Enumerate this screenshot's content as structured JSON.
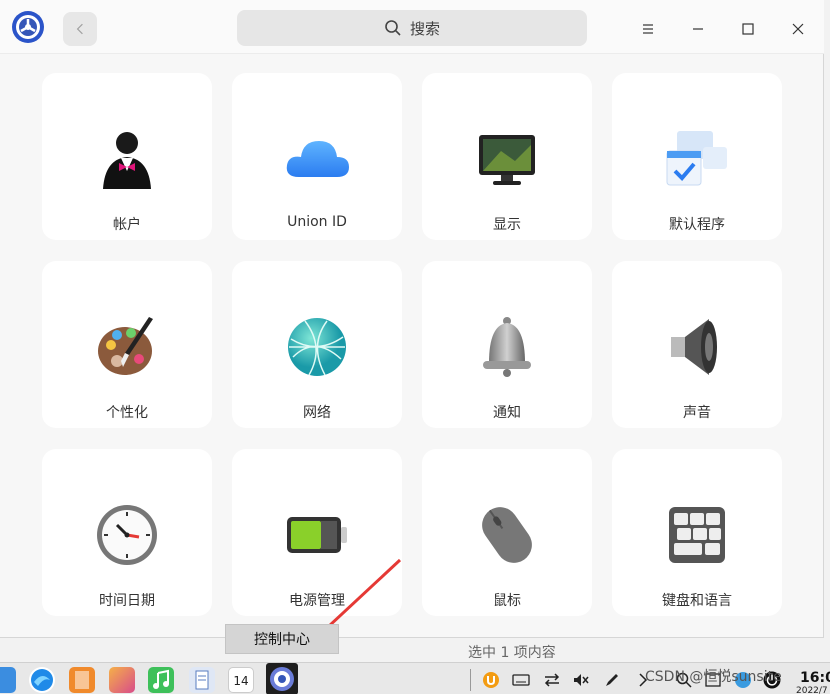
{
  "titlebar": {
    "search_placeholder": "搜索"
  },
  "modules": [
    {
      "label": "帐户",
      "icon": "account-icon"
    },
    {
      "label": "Union ID",
      "icon": "cloud-icon"
    },
    {
      "label": "显示",
      "icon": "display-icon"
    },
    {
      "label": "默认程序",
      "icon": "default-apps-icon"
    },
    {
      "label": "个性化",
      "icon": "palette-icon"
    },
    {
      "label": "网络",
      "icon": "network-globe-icon"
    },
    {
      "label": "通知",
      "icon": "bell-icon"
    },
    {
      "label": "声音",
      "icon": "speaker-icon"
    },
    {
      "label": "时间日期",
      "icon": "clock-icon"
    },
    {
      "label": "电源管理",
      "icon": "battery-icon"
    },
    {
      "label": "鼠标",
      "icon": "mouse-icon"
    },
    {
      "label": "键盘和语言",
      "icon": "keyboard-icon"
    }
  ],
  "tooltip": "控制中心",
  "status": "选中 1 项内容",
  "dock": {
    "calendar_day": "14",
    "watermark": "CSDN @恒悦sunsite",
    "clock_time": "16:0",
    "clock_date": "2022/7"
  },
  "colors": {
    "accent": "#3d7bf7",
    "window_bg": "#f7f7f7",
    "card_bg": "#ffffff",
    "arrow": "#e53935"
  }
}
